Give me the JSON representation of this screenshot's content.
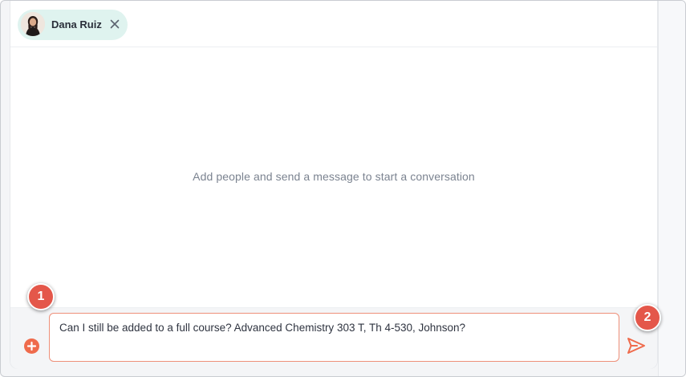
{
  "recipient": {
    "name": "Dana Ruiz",
    "remove_icon": "close-icon"
  },
  "conversation": {
    "empty_state": "Add people and send a message to start a conversation"
  },
  "composer": {
    "message_value": "Can I still be added to a full course? Advanced Chemistry 303 T, Th 4-530, Johnson?",
    "add_icon": "plus-circle-icon",
    "send_icon": "send-icon"
  },
  "callouts": [
    {
      "number": "1"
    },
    {
      "number": "2"
    }
  ],
  "colors": {
    "accent": "#ef6b4c",
    "chip_background": "#dff3ef",
    "callout": "#e4574a",
    "input_border": "#ee8f79"
  }
}
